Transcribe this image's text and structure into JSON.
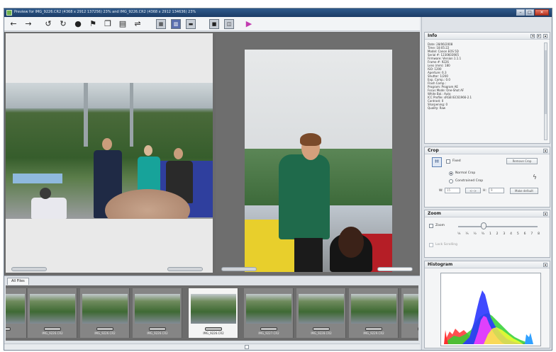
{
  "window": {
    "title": "Preview for IMG_9226.CR2 (4368 x 2912 137256) 23% and IMG_9226.CR2 (4368 x 2912 134636) 23%"
  },
  "toolbar": {
    "icons": [
      "back-arrow-icon",
      "forward-arrow-icon",
      "rotate-left-icon",
      "rotate-right-icon",
      "info-icon",
      "flag-icon",
      "copy-icon",
      "save-icon",
      "adjust-icon",
      "compare-icon",
      "split-view-icon",
      "gallery-icon",
      "single-view-icon",
      "dual-view-icon",
      "color-palette-icon"
    ]
  },
  "filmstrip": {
    "tab_label": "All Files",
    "thumbnails": [
      {
        "label": "",
        "selected": false
      },
      {
        "label": "IMG_9226.CR2",
        "selected": false
      },
      {
        "label": "IMG_9226.CR2",
        "selected": false
      },
      {
        "label": "IMG_9226.CR2",
        "selected": false
      },
      {
        "label": "IMG_9226.CR2",
        "selected": true
      },
      {
        "label": "IMG_9227.CR2",
        "selected": false
      },
      {
        "label": "IMG_9228.CR2",
        "selected": false
      },
      {
        "label": "IMG_9229.CR2",
        "selected": false
      },
      {
        "label": "",
        "selected": false
      }
    ]
  },
  "panel": {
    "info": {
      "title": "Info",
      "lines": [
        "Date: 28/06/2008",
        "Time: 18:05:22",
        "Model: Canon EOS 5D",
        "Serial #: 1230603905",
        "Firmware: Version 1.1.1",
        "Frame #: 9226",
        "Lens (mm): 180",
        "ISO: 1200",
        "Aperture: 6.3",
        "Shutter: 1/200",
        "Exp. Comp.: 0.0",
        "Flash Comp.:",
        "Program: Program AE",
        "Focus Mode: One-Shot AF",
        "White Bal.: Auto",
        "ICC Profile: sRGB IEC61966-2.1",
        "Contrast: 0",
        "Sharpening: 0",
        "Quality: Raw"
      ]
    },
    "crop": {
      "title": "Crop",
      "fixed_label": "Fixed",
      "remove_crop_label": "Remove Crop",
      "normal_crop_label": "Normal Crop",
      "constrained_crop_label": "Constrained Crop",
      "w_label": "W:",
      "h_label": "H:",
      "w_value": "15",
      "h_value": "9",
      "make_default_label": "Make default"
    },
    "zoom": {
      "title": "Zoom",
      "zoom_label": "Zoom",
      "levels": [
        "¼",
        "⅓",
        "½",
        "¾",
        "1",
        "2",
        "3",
        "4",
        "5",
        "6",
        "7",
        "8"
      ],
      "slider_position": 0.32,
      "lock_scrolling_label": "Lock Scrolling"
    },
    "histogram": {
      "title": "Histogram"
    }
  },
  "colors": {
    "titlebar": "#2f5a8c",
    "panel_bg": "#dfe3e8",
    "viewer_bg": "#6b6b6b"
  }
}
